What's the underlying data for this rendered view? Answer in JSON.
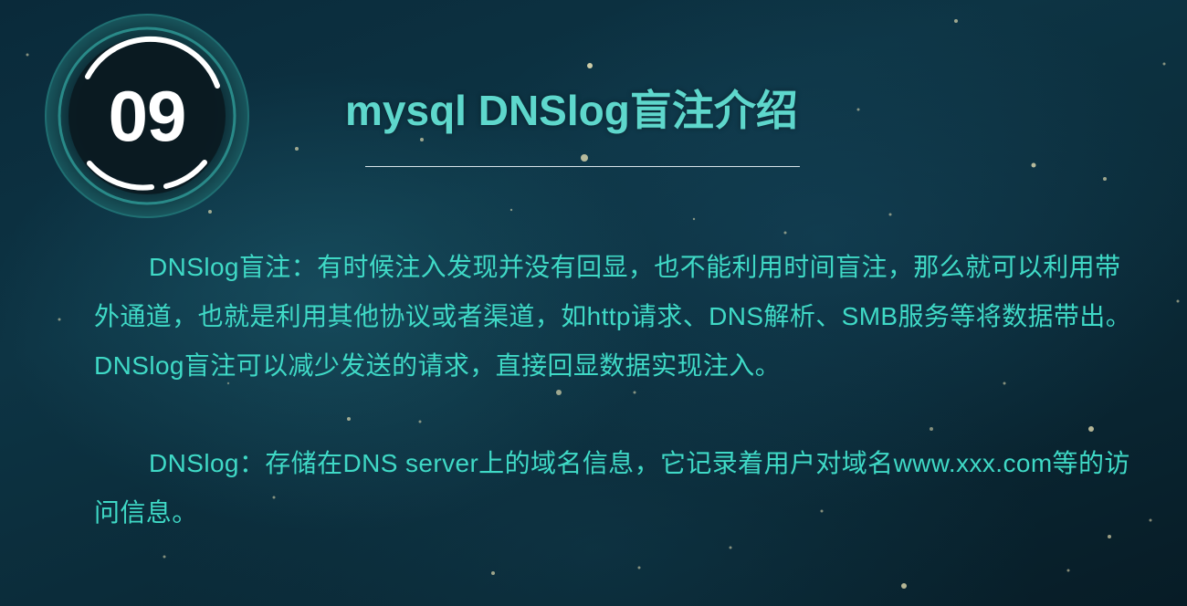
{
  "badge": {
    "number": "09"
  },
  "title": "mysql DNSlog盲注介绍",
  "paragraphs": [
    "DNSlog盲注：有时候注入发现并没有回显，也不能利用时间盲注，那么就可以利用带外通道，也就是利用其他协议或者渠道，如http请求、DNS解析、SMB服务等将数据带出。DNSlog盲注可以减少发送的请求，直接回显数据实现注入。",
    "DNSlog：存储在DNS server上的域名信息，它记录着用户对域名www.xxx.com等的访问信息。"
  ],
  "colors": {
    "title": "#5ed7cc",
    "body_text": "#3fd9c6",
    "badge_ring": "#ffffff",
    "badge_glow": "#3fb8b0",
    "background": "#0b2c3a"
  }
}
